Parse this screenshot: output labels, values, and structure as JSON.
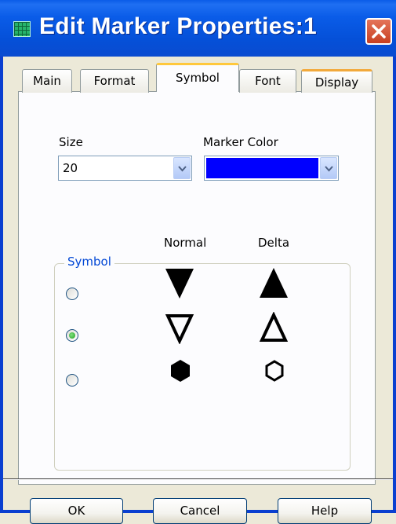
{
  "window": {
    "title": "Edit Marker Properties:1"
  },
  "tabs": [
    {
      "label": "Main"
    },
    {
      "label": "Format"
    },
    {
      "label": "Symbol",
      "selected": true
    },
    {
      "label": "Font"
    },
    {
      "label": "Display"
    }
  ],
  "size": {
    "label": "Size",
    "value": "20"
  },
  "marker_color": {
    "label": "Marker Color",
    "value": "#0000ff"
  },
  "symbol_group": {
    "label": "Symbol",
    "col_normal": "Normal",
    "col_delta": "Delta",
    "selected_row": 1,
    "rows": [
      {
        "normal": "filled-down-triangle",
        "delta": "filled-up-triangle"
      },
      {
        "normal": "hollow-down-triangle",
        "delta": "hollow-up-triangle"
      },
      {
        "normal": "filled-hexagon",
        "delta": "hollow-hexagon"
      }
    ]
  },
  "buttons": {
    "ok": "OK",
    "cancel": "Cancel",
    "help": "Help"
  }
}
